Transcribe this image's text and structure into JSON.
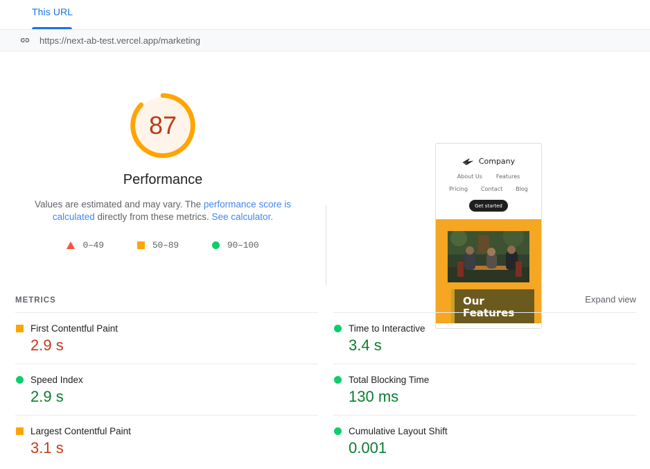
{
  "tabs": {
    "active_label": "This URL"
  },
  "url_bar": {
    "icon": "link-icon",
    "url": "https://next-ab-test.vercel.app/marketing"
  },
  "score": {
    "value": "87",
    "category_title": "Performance",
    "description_part1": "Values are estimated and may vary. The ",
    "description_link1": "performance score is calculated",
    "description_part2": " directly from these metrics. ",
    "description_link2": "See calculator.",
    "arc_color": "#ffa400",
    "arc_fill": "#fef4ea",
    "value_color": "#b93d18",
    "percent": 87
  },
  "legend": [
    {
      "shape": "triangle",
      "label": "0–49",
      "color": "#ff4e42"
    },
    {
      "shape": "square",
      "label": "50–89",
      "color": "#ffa400"
    },
    {
      "shape": "circle",
      "label": "90–100",
      "color": "#0cce6b"
    }
  ],
  "thumbnail": {
    "brand_name": "Company",
    "nav_row1": [
      "About Us",
      "Features"
    ],
    "nav_row2": [
      "Pricing",
      "Contact",
      "Blog"
    ],
    "cta_label": "Get started",
    "hero_bg": "#f5a623",
    "feature_title": "Our Features",
    "feature_bg": "#6b5a1e"
  },
  "metrics": {
    "section_title": "METRICS",
    "expand_label": "Expand view",
    "left_column": [
      {
        "marker": "square",
        "label": "First Contentful Paint",
        "value": "2.9 s",
        "rating": "average"
      },
      {
        "marker": "circle",
        "label": "Speed Index",
        "value": "2.9 s",
        "rating": "good"
      },
      {
        "marker": "square",
        "label": "Largest Contentful Paint",
        "value": "3.1 s",
        "rating": "average"
      }
    ],
    "right_column": [
      {
        "marker": "circle",
        "label": "Time to Interactive",
        "value": "3.4 s",
        "rating": "good"
      },
      {
        "marker": "circle",
        "label": "Total Blocking Time",
        "value": "130 ms",
        "rating": "good"
      },
      {
        "marker": "circle",
        "label": "Cumulative Layout Shift",
        "value": "0.001",
        "rating": "good"
      }
    ]
  }
}
